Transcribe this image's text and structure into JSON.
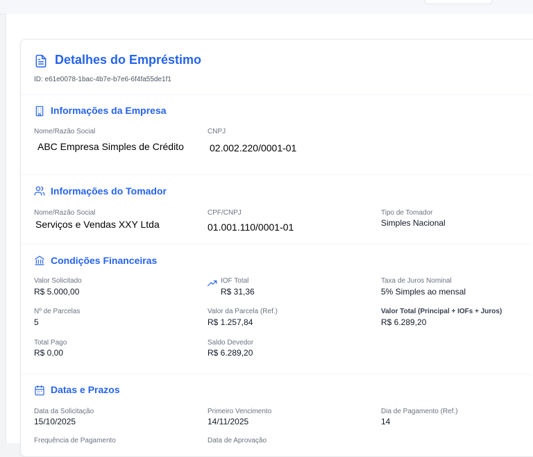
{
  "loan": {
    "title": "Detalhes do Empréstimo",
    "id_text": "ID: e61e0078-1bac-4b7e-b7e6-6f4fa55de1f1"
  },
  "empresa": {
    "title": "Informações da Empresa",
    "nome_label": "Nome/Razão Social",
    "nome_value": "ABC Empresa Simples de Crédito",
    "cnpj_label": "CNPJ",
    "cnpj_value": "02.002.220/0001-01"
  },
  "tomador": {
    "title": "Informações do Tomador",
    "nome_label": "Nome/Razão Social",
    "nome_value": "Serviços e Vendas XXY Ltda",
    "doc_label": "CPF/CNPJ",
    "doc_value": "01.001.110/0001-01",
    "tipo_label": "Tipo de Tomador",
    "tipo_value": "Simples Nacional"
  },
  "financeiro": {
    "title": "Condições Financeiras",
    "valor_solicitado_label": "Valor Solicitado",
    "valor_solicitado_value": "R$ 5.000,00",
    "iof_label": "IOF Total",
    "iof_value": "R$ 31,36",
    "taxa_label": "Taxa de Juros Nominal",
    "taxa_value": "5% Simples ao mensal",
    "parcelas_label": "Nº de Parcelas",
    "parcelas_value": "5",
    "valor_parcela_label": "Valor da Parcela (Ref.)",
    "valor_parcela_value": "R$ 1.257,84",
    "valor_total_label": "Valor Total (Principal + IOFs + Juros)",
    "valor_total_value": "R$ 6.289,20",
    "total_pago_label": "Total Pago",
    "total_pago_value": "R$ 0,00",
    "saldo_label": "Saldo Devedor",
    "saldo_value": "R$ 6.289,20"
  },
  "datas": {
    "title": "Datas e Prazos",
    "solicitacao_label": "Data da Solicitação",
    "solicitacao_value": "15/10/2025",
    "vencimento_label": "Primeiro Vencimento",
    "vencimento_value": "14/11/2025",
    "dia_pagamento_label": "Dia de Pagamento (Ref.)",
    "dia_pagamento_value": "14",
    "frequencia_label": "Frequência de Pagamento",
    "aprovacao_label": "Data de Aprovação"
  },
  "theme": {
    "accent": "#2563eb",
    "label_color": "#6b7280",
    "border": "#e5e7eb"
  }
}
